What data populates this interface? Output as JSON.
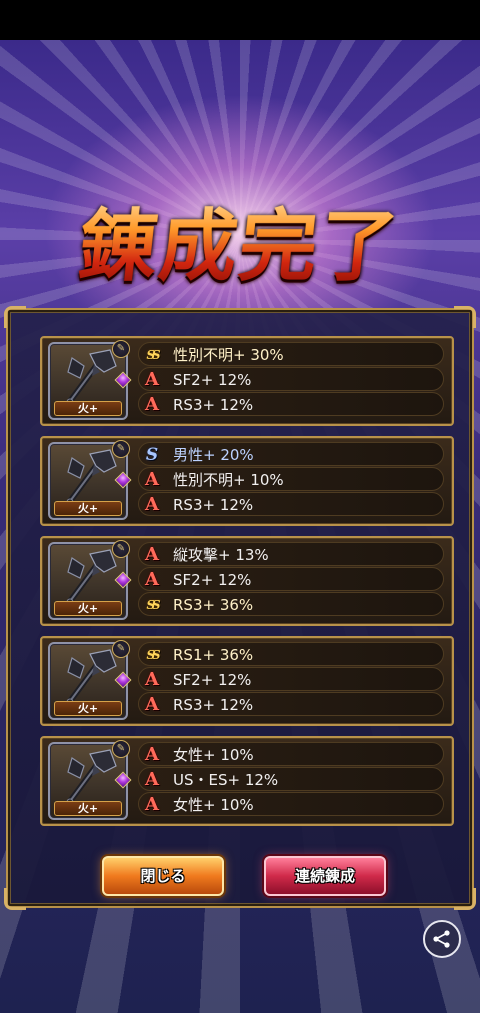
{
  "banner": {
    "title": "錬成完了"
  },
  "cards": [
    {
      "badge": "火+",
      "slot_icon": "axe-slot-icon",
      "rows": [
        {
          "rank": "SS",
          "text": "性別不明+ 30%"
        },
        {
          "rank": "A",
          "text": "SF2+ 12%"
        },
        {
          "rank": "A",
          "text": "RS3+ 12%"
        }
      ]
    },
    {
      "badge": "火+",
      "slot_icon": "axe-slot-icon",
      "rows": [
        {
          "rank": "S",
          "text": "男性+ 20%"
        },
        {
          "rank": "A",
          "text": "性別不明+ 10%"
        },
        {
          "rank": "A",
          "text": "RS3+ 12%"
        }
      ]
    },
    {
      "badge": "火+",
      "slot_icon": "axe-slot-icon",
      "rows": [
        {
          "rank": "A",
          "text": "縦攻撃+ 13%"
        },
        {
          "rank": "A",
          "text": "SF2+ 12%"
        },
        {
          "rank": "SS",
          "text": "RS3+ 36%"
        }
      ]
    },
    {
      "badge": "火+",
      "slot_icon": "axe-slot-icon",
      "rows": [
        {
          "rank": "SS",
          "text": "RS1+ 36%"
        },
        {
          "rank": "A",
          "text": "SF2+ 12%"
        },
        {
          "rank": "A",
          "text": "RS3+ 12%"
        }
      ]
    },
    {
      "badge": "火+",
      "slot_icon": "axe-slot-icon",
      "rows": [
        {
          "rank": "A",
          "text": "女性+ 10%"
        },
        {
          "rank": "A",
          "text": "US・ES+ 12%"
        },
        {
          "rank": "A",
          "text": "女性+ 10%"
        }
      ]
    }
  ],
  "buttons": {
    "close": "閉じる",
    "continue": "連続錬成"
  },
  "icons": {
    "weapon": "dark-axe-icon",
    "share": "share-icon",
    "gem": "purple-gem-icon"
  },
  "colors": {
    "frame_gold": "#b8924a",
    "rank_a": "#ff6a5a",
    "rank_ss": "#ffd55a",
    "rank_s": "#a8c6ff"
  }
}
